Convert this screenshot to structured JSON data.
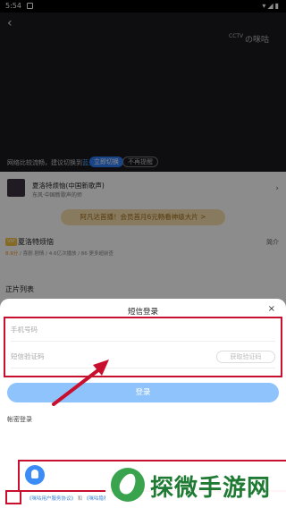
{
  "status_bar": {
    "time": "5:54"
  },
  "player": {
    "logo_cctv": "CCTV",
    "logo_miao": "の咪咕",
    "hint_prefix": "网络比较流畅，建议切换到",
    "hint_highlight": "蓝光",
    "switch_label": "立即切换",
    "no_remind_label": "不再提醒"
  },
  "page": {
    "song": {
      "title": "夏洛特烦恼(中国新歌声)",
      "subtitle": "东风·中国新歌声的师"
    },
    "promo": "阿凡达首播！会员首月6元畅看神级大片 >",
    "show": {
      "badge": "VIP",
      "title": "夏洛特烦恼",
      "intro": "简介",
      "score": "8.9分",
      "meta": " / 喜剧 剧情 / 4.6亿次播放 / 86 更多超前查"
    },
    "section_title": "正片列表"
  },
  "login_sheet": {
    "title": "短信登录",
    "close_icon": "×",
    "phone_placeholder": "手机号码",
    "code_placeholder": "短信验证码",
    "get_code_label": "获取验证码",
    "login_button": "登录",
    "password_login": "帐密登录",
    "agree_prefix": "《咪咕用户服务协议》",
    "agree_and": "和",
    "agree_link2": "《咪咕隐私"
  },
  "watermark": {
    "text": "探微手游网"
  },
  "colors": {
    "annotation_red": "#c8102e",
    "login_blue": "#8fc3fb",
    "watermark_green": "#1f7b34"
  }
}
